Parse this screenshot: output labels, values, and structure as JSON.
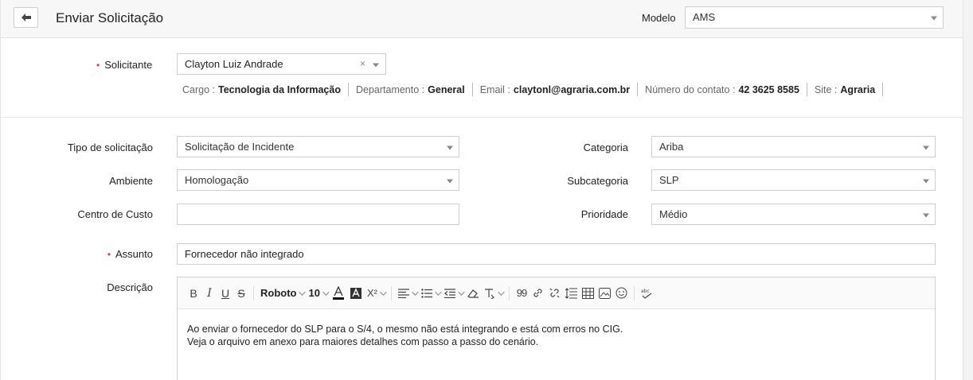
{
  "header": {
    "title": "Enviar Solicitação",
    "back_icon": "arrow-left-icon",
    "template_label": "Modelo",
    "template_value": "AMS"
  },
  "requester": {
    "label": "Solicitante",
    "value": "Clayton Luiz Andrade",
    "clear_glyph": "×",
    "details": [
      {
        "key": "Cargo :",
        "value": "Tecnologia da Informação"
      },
      {
        "key": "Departamento :",
        "value": "General"
      },
      {
        "key": "Email :",
        "value": "claytonl@agraria.com.br"
      },
      {
        "key": "Número do contato :",
        "value": "42 3625 8585"
      },
      {
        "key": "Site :",
        "value": "Agraria"
      }
    ]
  },
  "fields": {
    "request_type": {
      "label": "Tipo de solicitação",
      "value": "Solicitação de Incidente"
    },
    "environment": {
      "label": "Ambiente",
      "value": "Homologação"
    },
    "cost_center": {
      "label": "Centro de Custo",
      "value": ""
    },
    "category": {
      "label": "Categoria",
      "value": "Ariba"
    },
    "subcategory": {
      "label": "Subcategoria",
      "value": "SLP"
    },
    "priority": {
      "label": "Prioridade",
      "value": "Médio"
    },
    "subject": {
      "label": "Assunto",
      "value": "Fornecedor não integrado"
    },
    "description": {
      "label": "Descrição",
      "lines": [
        "Ao enviar o fornecedor do SLP para o S/4, o mesmo não está integrando e está com erros no CIG.",
        "Veja o arquivo em anexo para maiores detalhes com passo a passo do cenário."
      ]
    }
  },
  "toolbar": {
    "bold": "B",
    "italic": "I",
    "underline": "U",
    "strike": "S",
    "font_family": "Roboto",
    "font_size": "10",
    "superscript": "X²"
  },
  "colors": {
    "required": "#e23c3c",
    "border": "#cfcfcf",
    "header_bg": "#f7f7f7"
  }
}
